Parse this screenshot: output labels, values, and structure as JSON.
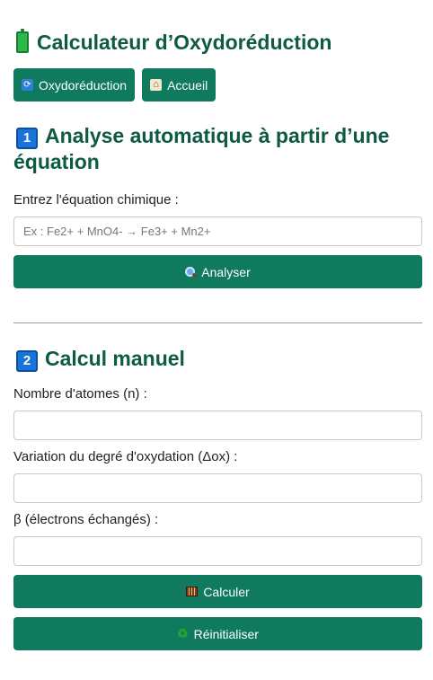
{
  "app": {
    "title": "Calculateur d’Oxydoréduction",
    "title_icon": "battery-icon"
  },
  "nav": {
    "buttons": [
      {
        "label": "Oxydoréduction",
        "icon": "refresh-icon"
      },
      {
        "label": "Accueil",
        "icon": "house-icon"
      }
    ]
  },
  "section_auto": {
    "number": "1",
    "title": "Analyse automatique à partir d’une équation",
    "equation_label": "Entrez l'équation chimique :",
    "equation_placeholder": "Ex : Fe2+ + MnO4- → Fe3+ + Mn2+",
    "equation_value": "",
    "analyze_button": "Analyser",
    "analyze_icon": "magnifier-icon"
  },
  "section_manual": {
    "number": "2",
    "title": "Calcul manuel",
    "atoms_label": "Nombre d'atomes (n) :",
    "atoms_value": "",
    "delta_label": "Variation du degré d'oxydation (Δox) :",
    "delta_value": "",
    "beta_label": "β (électrons échangés) :",
    "beta_value": "",
    "calculate_button": "Calculer",
    "calculate_icon": "abacus-icon",
    "reset_button": "Réinitialiser",
    "reset_icon": "recycle-icon"
  },
  "colors": {
    "primary": "#0f7a5e",
    "heading": "#0d5a45",
    "badge": "#1a73d9"
  }
}
